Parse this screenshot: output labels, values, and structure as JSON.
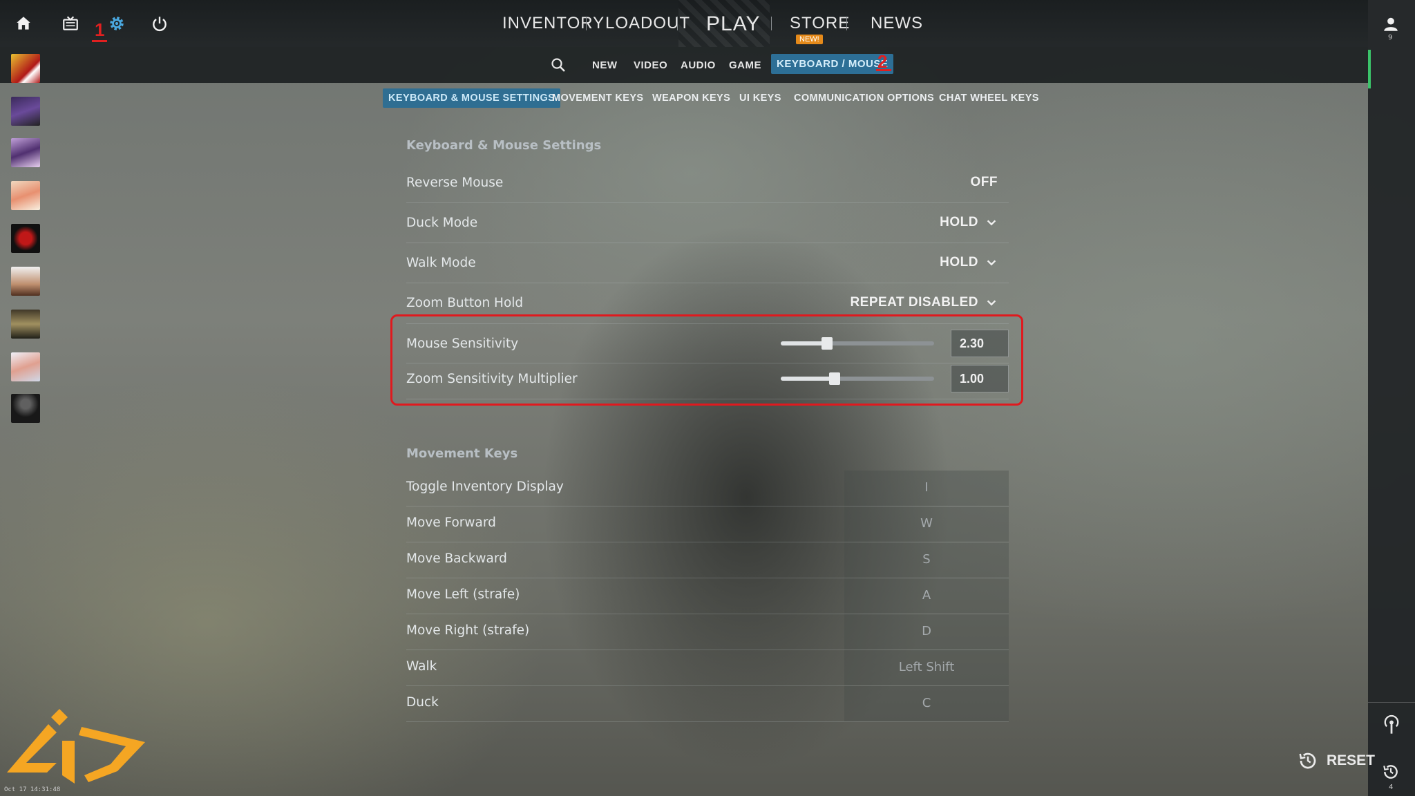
{
  "topnav": {
    "annotations": {
      "settings_marker": "1",
      "tab_marker": "2"
    },
    "items": [
      "INVENTORY",
      "LOADOUT",
      "PLAY",
      "STORE",
      "NEWS"
    ],
    "store_badge": "NEW!",
    "profile_count": "9"
  },
  "subnav": {
    "items": [
      "NEW",
      "VIDEO",
      "AUDIO",
      "GAME",
      "KEYBOARD / MOUSE"
    ],
    "active": "KEYBOARD / MOUSE"
  },
  "tabs": {
    "items": [
      "KEYBOARD & MOUSE SETTINGS",
      "MOVEMENT KEYS",
      "WEAPON KEYS",
      "UI KEYS",
      "COMMUNICATION OPTIONS",
      "CHAT WHEEL KEYS"
    ],
    "active": "KEYBOARD & MOUSE SETTINGS"
  },
  "kms": {
    "title": "Keyboard & Mouse Settings",
    "rows": [
      {
        "label": "Reverse Mouse",
        "value": "OFF"
      },
      {
        "label": "Duck Mode",
        "value": "HOLD"
      },
      {
        "label": "Walk Mode",
        "value": "HOLD"
      },
      {
        "label": "Zoom Button Hold",
        "value": "REPEAT DISABLED"
      }
    ],
    "sliders": [
      {
        "label": "Mouse Sensitivity",
        "value": "2.30",
        "fraction": 0.3
      },
      {
        "label": "Zoom Sensitivity Multiplier",
        "value": "1.00",
        "fraction": 0.35
      }
    ]
  },
  "movement": {
    "title": "Movement Keys",
    "rows": [
      {
        "label": "Toggle Inventory Display",
        "key": "I"
      },
      {
        "label": "Move Forward",
        "key": "W"
      },
      {
        "label": "Move Backward",
        "key": "S"
      },
      {
        "label": "Move Left (strafe)",
        "key": "A"
      },
      {
        "label": "Move Right (strafe)",
        "key": "D"
      },
      {
        "label": "Walk",
        "key": "Left Shift"
      },
      {
        "label": "Duck",
        "key": "C"
      }
    ]
  },
  "footer": {
    "reset_label": "RESET",
    "history_count": "4",
    "timestamp": "Oct 17 14:31:48"
  },
  "colors": {
    "accent": "#2d6f96",
    "highlight": "#e0191e",
    "badge": "#e58a1a",
    "logo": "#f5a623"
  }
}
